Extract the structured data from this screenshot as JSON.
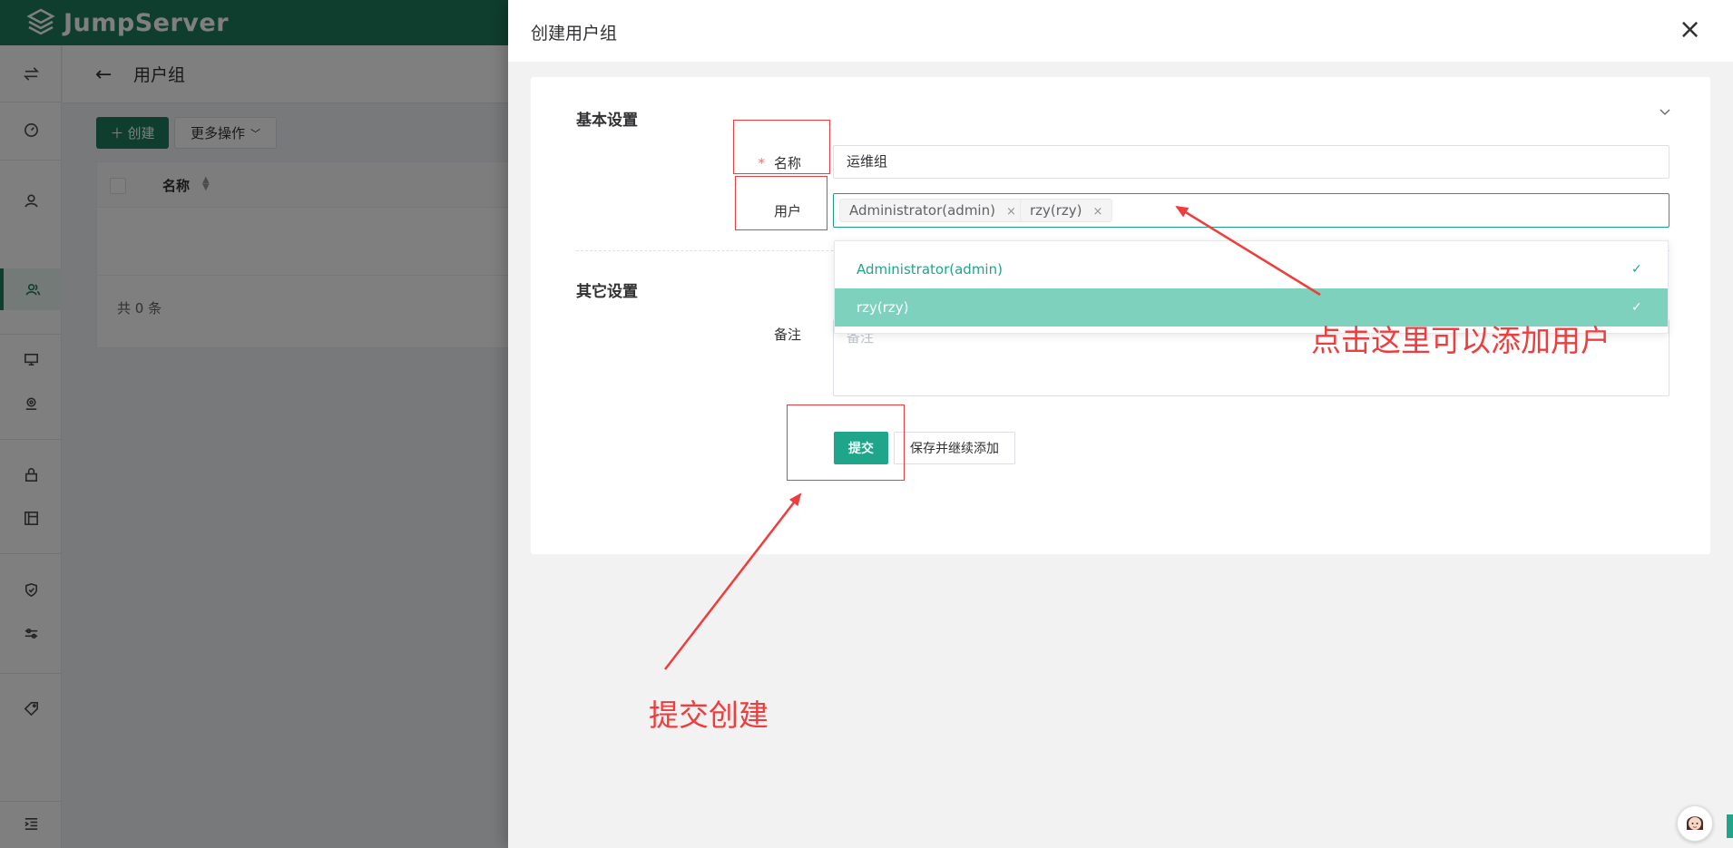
{
  "app": {
    "logo_text": "JumpServer"
  },
  "page": {
    "title": "用户组",
    "create_label": "创建",
    "more_actions_label": "更多操作",
    "table": {
      "columns": [
        "名称"
      ],
      "total": "共 0 条"
    }
  },
  "drawer": {
    "title": "创建用户组",
    "basic_section": "基本设置",
    "other_section": "其它设置",
    "fields": {
      "name_label": "名称",
      "name_value": "运维组",
      "users_label": "用户",
      "users_tags": [
        "Administrator(admin)",
        "rzy(rzy)"
      ],
      "comment_label": "备注",
      "comment_placeholder": "备注"
    },
    "dropdown_options": [
      "Administrator(admin)",
      "rzy(rzy)"
    ],
    "submit_label": "提交",
    "save_continue_label": "保存并继续添加"
  },
  "annotations": {
    "add_users": "点击这里可以添加用户",
    "submit_create": "提交创建"
  },
  "colors": {
    "brand": "#1f7a5c",
    "accent": "#1fa58a",
    "annotation": "#f03c3c"
  }
}
